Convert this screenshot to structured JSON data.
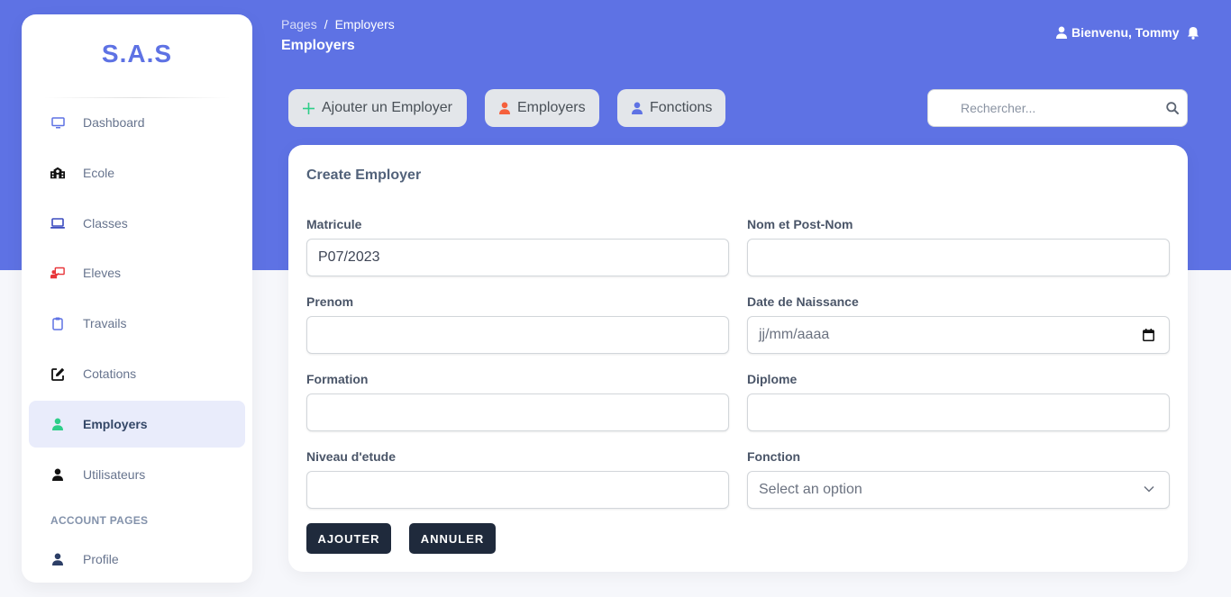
{
  "brand": {
    "name": "S.A.S",
    "color": "#5e72e4"
  },
  "sidebar": {
    "items": [
      {
        "label": "Dashboard",
        "icon": "desktop-icon"
      },
      {
        "label": "Ecole",
        "icon": "school-icon"
      },
      {
        "label": "Classes",
        "icon": "laptop-icon"
      },
      {
        "label": "Eleves",
        "icon": "chalkboard-teacher-icon"
      },
      {
        "label": "Travails",
        "icon": "clipboard-icon"
      },
      {
        "label": "Cotations",
        "icon": "edit-icon"
      },
      {
        "label": "Employers",
        "icon": "user-icon",
        "active": true
      },
      {
        "label": "Utilisateurs",
        "icon": "user-icon"
      }
    ],
    "section_title": "ACCOUNT PAGES",
    "account_items": [
      {
        "label": "Profile",
        "icon": "user-icon"
      }
    ]
  },
  "header": {
    "breadcrumb_root": "Pages",
    "breadcrumb_sep": "/",
    "breadcrumb_current": "Employers",
    "title": "Employers",
    "greeting": "Bienvenu, Tommy"
  },
  "toolbar": {
    "add_label": "Ajouter un Employer",
    "employers_label": "Employers",
    "fonctions_label": "Fonctions",
    "search_placeholder": "Rechercher..."
  },
  "form": {
    "title": "Create Employer",
    "fields": {
      "matricule": {
        "label": "Matricule",
        "value": "P07/2023"
      },
      "nom": {
        "label": "Nom et Post-Nom",
        "value": ""
      },
      "prenom": {
        "label": "Prenom",
        "value": ""
      },
      "date_naissance": {
        "label": "Date de Naissance",
        "placeholder": "jj/mm/aaaa"
      },
      "formation": {
        "label": "Formation",
        "value": ""
      },
      "diplome": {
        "label": "Diplome",
        "value": ""
      },
      "niveau": {
        "label": "Niveau d'etude",
        "value": ""
      },
      "fonction": {
        "label": "Fonction",
        "selected": "Select an option"
      }
    },
    "submit_label": "AJOUTER",
    "cancel_label": "ANNULER"
  },
  "colors": {
    "primary": "#5e72e4",
    "employers_icon": "#f5603c",
    "plus_icon": "#2dce89",
    "active_icon": "#2dce89",
    "eleves_icon": "#f5365c",
    "dark_button": "#1f2a3c"
  }
}
